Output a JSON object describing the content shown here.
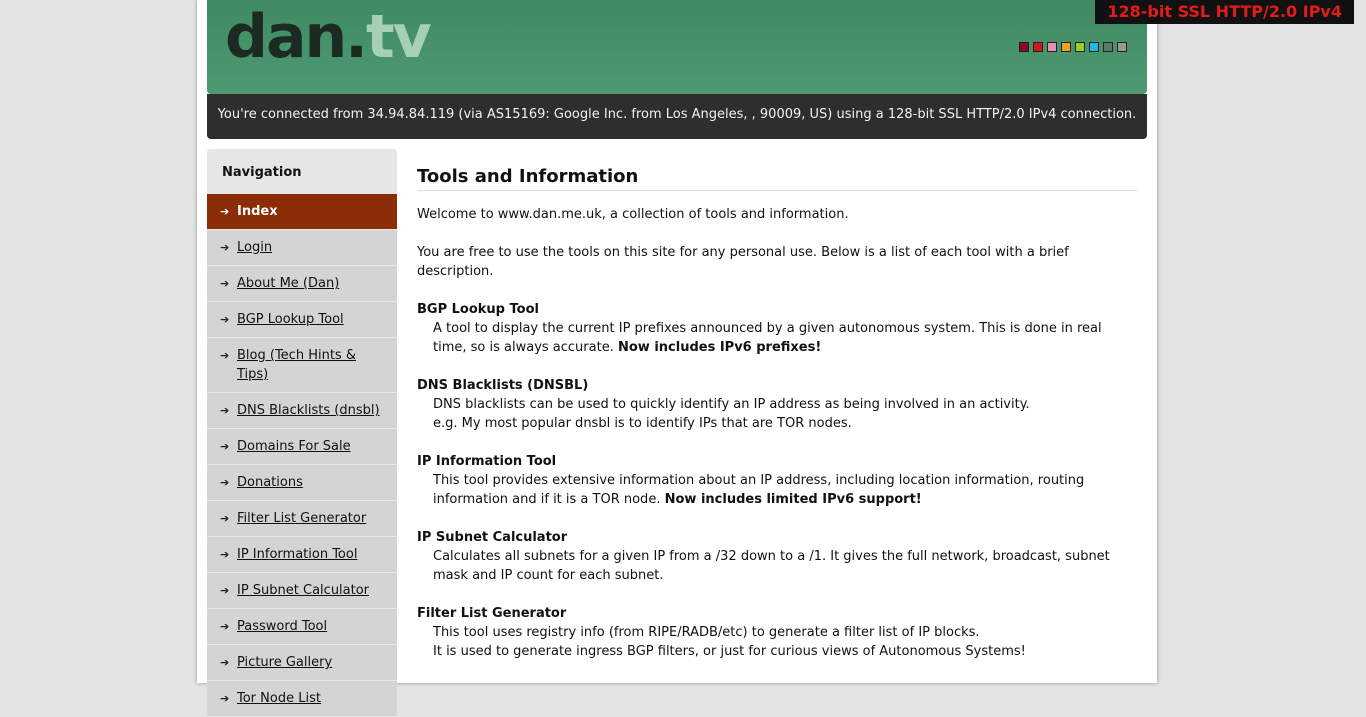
{
  "header": {
    "logo_main": "dan.",
    "logo_tv": "tv",
    "ssl_badge": "128-bit SSL HTTP/2.0 IPv4",
    "swatches": [
      "#8b0a2a",
      "#cc1a1a",
      "#e88fb0",
      "#f0a020",
      "#9acd32",
      "#25b8e0",
      "#5a7a6a",
      "#9a9a90"
    ],
    "connection_text": "You're connected from 34.94.84.119 (via AS15169: Google Inc. from Los Angeles, , 90009, US) using a 128-bit SSL HTTP/2.0 IPv4 connection."
  },
  "nav": {
    "title": "Navigation",
    "arrow_icon": "➔",
    "items": [
      {
        "label": "Index",
        "active": true
      },
      {
        "label": "Login"
      },
      {
        "label": "About Me (Dan)"
      },
      {
        "label": "BGP Lookup Tool"
      },
      {
        "label": "Blog (Tech Hints & Tips)"
      },
      {
        "label": "DNS Blacklists (dnsbl)"
      },
      {
        "label": "Domains For Sale"
      },
      {
        "label": "Donations"
      },
      {
        "label": "Filter List Generator"
      },
      {
        "label": "IP Information Tool"
      },
      {
        "label": "IP Subnet Calculator"
      },
      {
        "label": "Password Tool"
      },
      {
        "label": "Picture Gallery"
      },
      {
        "label": "Tor Node List"
      }
    ]
  },
  "main": {
    "title": "Tools and Information",
    "intro1": "Welcome to www.dan.me.uk, a collection of tools and information.",
    "intro2": "You are free to use the tools on this site for any personal use. Below is a list of each tool with a brief description.",
    "tools": [
      {
        "name": "BGP Lookup Tool",
        "desc": "A tool to display the current IP prefixes announced by a given autonomous system. This is done in real time, so is always accurate.",
        "highlight": "Now includes IPv6 prefixes!"
      },
      {
        "name": "DNS Blacklists (DNSBL)",
        "desc": "DNS blacklists can be used to quickly identify an IP address as being involved in an activity.",
        "desc2": "e.g. My most popular dnsbl is to identify IPs that are TOR nodes."
      },
      {
        "name": "IP Information Tool",
        "desc": "This tool provides extensive information about an IP address, including location information, routing information and if it is a TOR node.",
        "highlight": "Now includes limited IPv6 support!"
      },
      {
        "name": "IP Subnet Calculator",
        "desc": "Calculates all subnets for a given IP from a /32 down to a /1. It gives the full network, broadcast, subnet mask and IP count for each subnet."
      },
      {
        "name": "Filter List Generator",
        "desc": "This tool uses registry info (from RIPE/RADB/etc) to generate a filter list of IP blocks.",
        "desc2": "It is used to generate ingress BGP filters, or just for curious views of Autonomous Systems!"
      }
    ]
  }
}
